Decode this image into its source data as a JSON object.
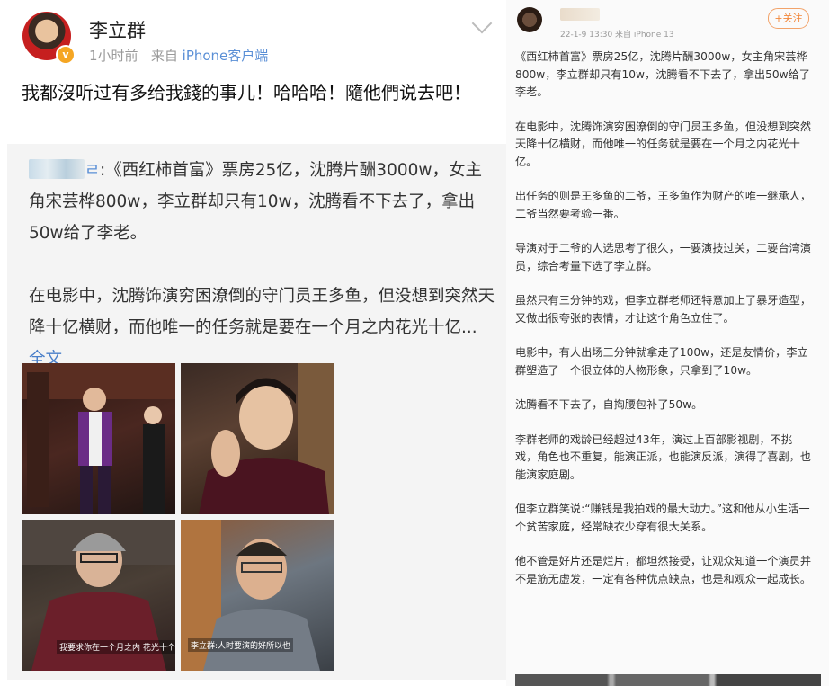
{
  "left_post": {
    "author": "李立群",
    "time": "1小时前",
    "source_prefix": "来自",
    "source": "iPhone客户端",
    "verified_badge": "v",
    "text": "我都沒听过有多给我錢的事儿！哈哈哈！隨他們说去吧！",
    "repost": {
      "link_glyph": "ㄹ",
      "para1": ":《西红柿首富》票房25亿，沈腾片酬3000w，女主角宋芸桦800w，李立群却只有10w，沈腾看不下去了，拿出50w给了李老。",
      "para2": "在电影中，沈腾饰演穷困潦倒的守门员王多鱼，但没想到突然天降十亿横财，而他唯一的任务就是要在一个月之内花光十亿...",
      "more_link": "全文",
      "images": [
        {
          "name": "stage-scene",
          "caption": ""
        },
        {
          "name": "actor-closeup",
          "caption": ""
        },
        {
          "name": "elder-in-robe",
          "caption": "我要求你在一个月之内 花光十个亿"
        },
        {
          "name": "interview-shot",
          "caption": "李立群:人时要演的好所以也"
        }
      ]
    }
  },
  "right_post": {
    "meta": "22-1-9 13:30  来自 iPhone 13",
    "follow_label": "+关注",
    "paragraphs": [
      "《西红柿首富》票房25亿，沈腾片酬3000w，女主角宋芸桦800w，李立群却只有10w，沈腾看不下去了，拿出50w给了李老。",
      "在电影中，沈腾饰演穷困潦倒的守门员王多鱼，但没想到突然天降十亿横财，而他唯一的任务就是要在一个月之内花光十亿。",
      "出任务的则是王多鱼的二爷，王多鱼作为财产的唯一继承人，二爷当然要考验一番。",
      "导演对于二爷的人选思考了很久，一要演技过关，二要台湾演员，综合考量下选了李立群。",
      "虽然只有三分钟的戏，但李立群老师还特意加上了暴牙造型，又做出很夸张的表情，才让这个角色立住了。",
      "电影中，有人出场三分钟就拿走了100w，还是友情价，李立群塑造了一个很立体的人物形象，只拿到了10w。",
      "沈腾看不下去了，自掏腰包补了50w。",
      "李群老师的戏龄已经超过43年，演过上百部影视剧，不挑戏，角色也不重复，能演正派，也能演反派，演得了喜剧，也能演家庭剧。",
      "但李立群笑说:“赚钱是我拍戏的最大动力。”这和他从小生活一个贫苦家庭，经常缺衣少穿有很大关系。",
      "他不管是好片还是烂片，都坦然接受，让观众知道一个演员并不是筋无虚发，一定有各种优点缺点，也是和观众一起成长。"
    ]
  }
}
